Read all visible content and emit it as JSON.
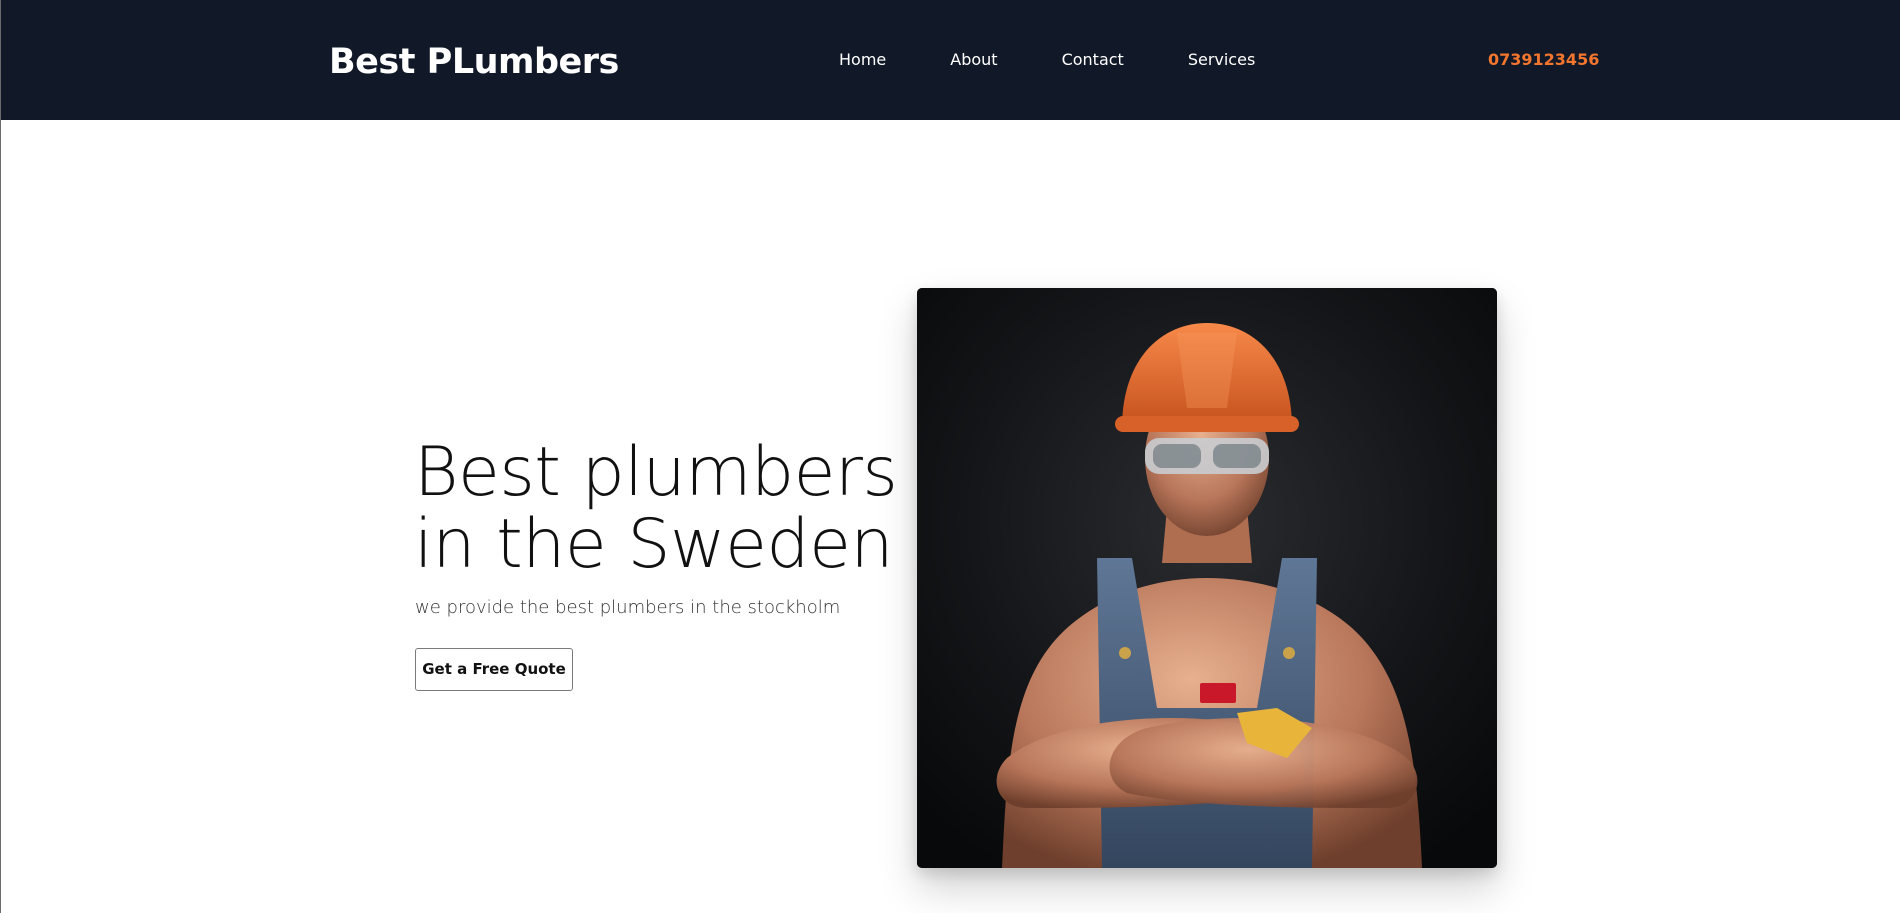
{
  "header": {
    "brand": "Best PLumbers",
    "nav": [
      {
        "label": "Home"
      },
      {
        "label": "About"
      },
      {
        "label": "Contact"
      },
      {
        "label": "Services"
      }
    ],
    "phone": "0739123456"
  },
  "hero": {
    "title_line1": "Best plumbers",
    "title_line2": "in the Sweden",
    "subtitle": "we provide the best plumbers in the stockholm",
    "cta_label": "Get a Free Quote",
    "image_alt": "plumber-portrait-image"
  },
  "colors": {
    "navbar_bg": "#111827",
    "accent": "#f2762e",
    "text": "#111111"
  }
}
